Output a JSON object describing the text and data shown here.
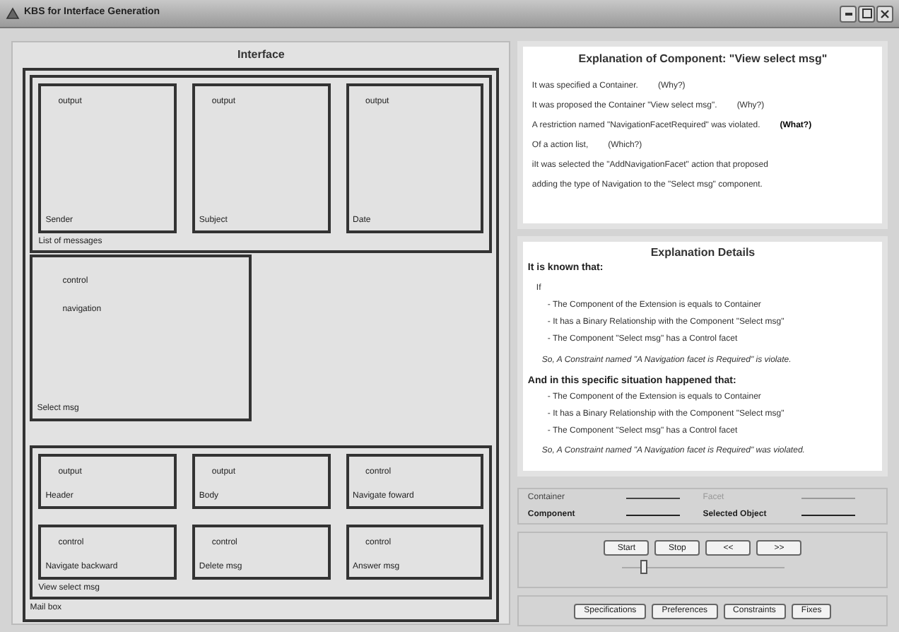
{
  "window": {
    "title": "KBS for Interface Generation"
  },
  "interface": {
    "title": "Interface",
    "mailbox": {
      "label": "Mail box",
      "list": {
        "label": "List of messages",
        "components": [
          {
            "facet": "output",
            "label": "Sender"
          },
          {
            "facet": "output",
            "label": "Subject"
          },
          {
            "facet": "output",
            "label": "Date"
          }
        ]
      },
      "select": {
        "label": "Select msg",
        "facets": [
          "control",
          "navigation"
        ]
      },
      "view": {
        "label": "View select msg",
        "components": [
          {
            "facet": "output",
            "label": "Header"
          },
          {
            "facet": "output",
            "label": "Body"
          },
          {
            "facet": "control",
            "label": "Navigate foward"
          },
          {
            "facet": "control",
            "label": "Navigate backward"
          },
          {
            "facet": "control",
            "label": "Delete msg"
          },
          {
            "facet": "control",
            "label": "Answer msg"
          }
        ]
      }
    }
  },
  "explanation": {
    "title": "Explanation of Component: \"View select msg\"",
    "lines": [
      {
        "text": "It was specified a Container.",
        "link": "(Why?)",
        "emphasized": false
      },
      {
        "text": "It was proposed the Container \"View select msg\".",
        "link": "(Why?)",
        "emphasized": false
      },
      {
        "text": "A restriction named \"NavigationFacetRequired\" was violated.",
        "link": "(What?)",
        "emphasized": true
      },
      {
        "text": "Of a action list,",
        "link": "(Which?)",
        "emphasized": false
      },
      {
        "text": "iIt was selected the \"AddNavigationFacet\" action that proposed"
      },
      {
        "text": "adding the type of Navigation to the \"Select msg\" component."
      }
    ]
  },
  "details": {
    "title": "Explanation Details",
    "sections": [
      {
        "heading": "It is known that:",
        "intro": "If",
        "items": [
          "- The Component of the Extension is equals to Container",
          "- It has a Binary Relationship with the Component \"Select msg\"",
          "- The Component \"Select msg\" has a Control facet"
        ],
        "conclusion": "So, A Constraint named \"A Navigation facet is Required\" is violate."
      },
      {
        "heading": "And in this specific situation happened that:",
        "items": [
          "- The Component of the Extension is equals to Container",
          "- It has a Binary Relationship with the Component \"Select msg\"",
          "- The Component \"Select msg\" has a Control facet"
        ],
        "conclusion": "So, A Constraint named \"A Navigation facet is Required\" was violated."
      }
    ]
  },
  "legend": [
    {
      "label": "Container",
      "kind": "plain"
    },
    {
      "label": "Facet",
      "kind": "muted"
    },
    {
      "label": "Component",
      "kind": "bold"
    },
    {
      "label": "Selected Object",
      "kind": "bold"
    }
  ],
  "player": {
    "buttons": [
      "Start",
      "Stop",
      "<<",
      ">>"
    ],
    "slider": {
      "level": 0.13
    }
  },
  "bottom_buttons": [
    "Specifications",
    "Preferences",
    "Constraints",
    "Fixes"
  ]
}
